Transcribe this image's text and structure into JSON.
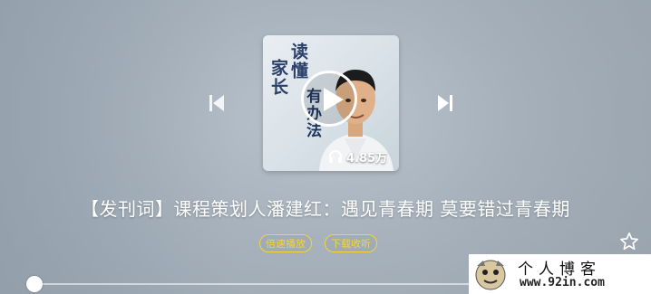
{
  "cover": {
    "title_line_1": "读懂",
    "title_line_2": "家长",
    "title_line_3": "有办法",
    "listen_count": "4.85万"
  },
  "track": {
    "title": "【发刊词】课程策划人潘建红：遇见青春期 莫要错过青春期"
  },
  "actions": {
    "speed_label": "倍速播放",
    "download_label": "下载收听"
  },
  "progress": {
    "fraction": 0.0
  },
  "watermark": {
    "title": "个人博客",
    "url": "www.92in.com"
  },
  "colors": {
    "accent": "#f6d33a",
    "title_text": "#ffffff"
  }
}
